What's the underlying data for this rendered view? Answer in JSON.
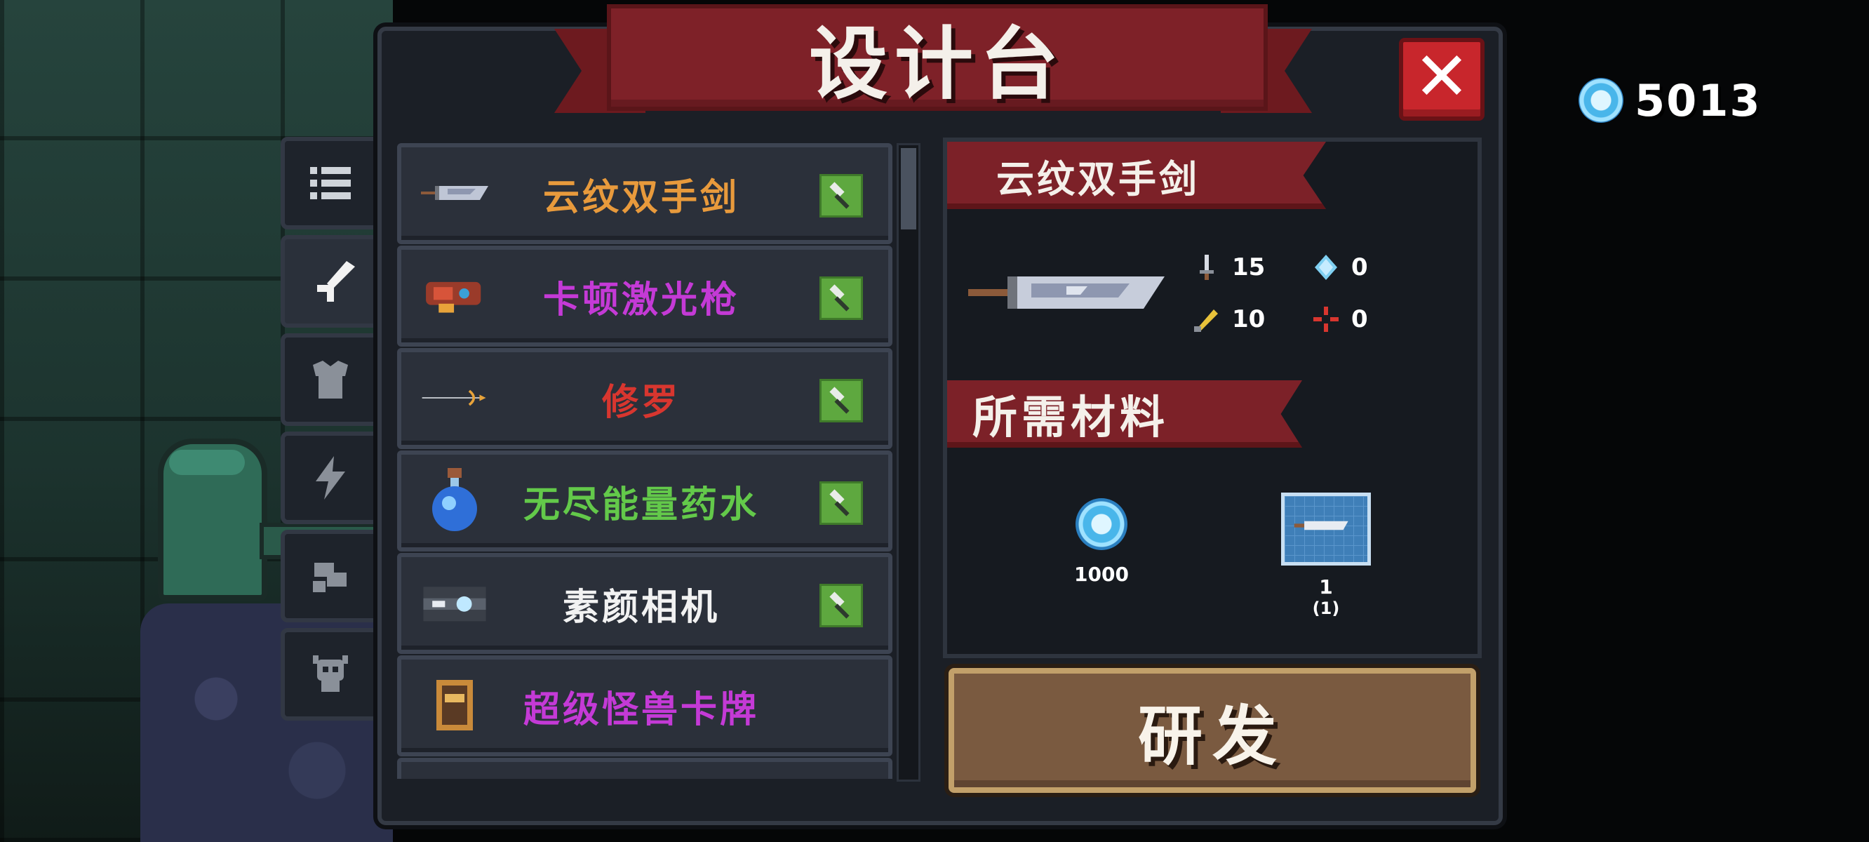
{
  "currency": {
    "icon": "blue-gem-icon",
    "amount": "5013"
  },
  "dialog": {
    "title": "设计台",
    "close_icon": "close-icon"
  },
  "tabs": [
    {
      "icon": "list-icon",
      "active": false
    },
    {
      "icon": "weapon-icon",
      "active": true
    },
    {
      "icon": "armor-icon",
      "active": false
    },
    {
      "icon": "lightning-icon",
      "active": false
    },
    {
      "icon": "robot-icon",
      "active": false
    },
    {
      "icon": "monster-icon",
      "active": false
    }
  ],
  "items": [
    {
      "name": "云纹双手剑",
      "color": "#e89a3c",
      "icon": "greatsword-icon",
      "craftable": true
    },
    {
      "name": "卡顿激光枪",
      "color": "#c43ad6",
      "icon": "laser-gun-icon",
      "craftable": true
    },
    {
      "name": "修罗",
      "color": "#d8362f",
      "icon": "bow-icon",
      "craftable": true
    },
    {
      "name": "无尽能量药水",
      "color": "#63c94a",
      "icon": "potion-icon",
      "craftable": true
    },
    {
      "name": "素颜相机",
      "color": "#f2f2f2",
      "icon": "camera-icon",
      "craftable": true
    },
    {
      "name": "超级怪兽卡牌",
      "color": "#c43ad6",
      "icon": "card-icon",
      "craftable": false
    }
  ],
  "detail": {
    "name": "云纹双手剑",
    "stats": {
      "damage": "15",
      "energy": "0",
      "crit": "10",
      "precision": "0"
    },
    "materials_title": "所需材料",
    "materials": [
      {
        "icon": "blue-gem-icon",
        "count": "1000",
        "sub": ""
      },
      {
        "icon": "blueprint-icon",
        "count": "1",
        "sub": "(1)"
      }
    ]
  },
  "research_button": "研发"
}
